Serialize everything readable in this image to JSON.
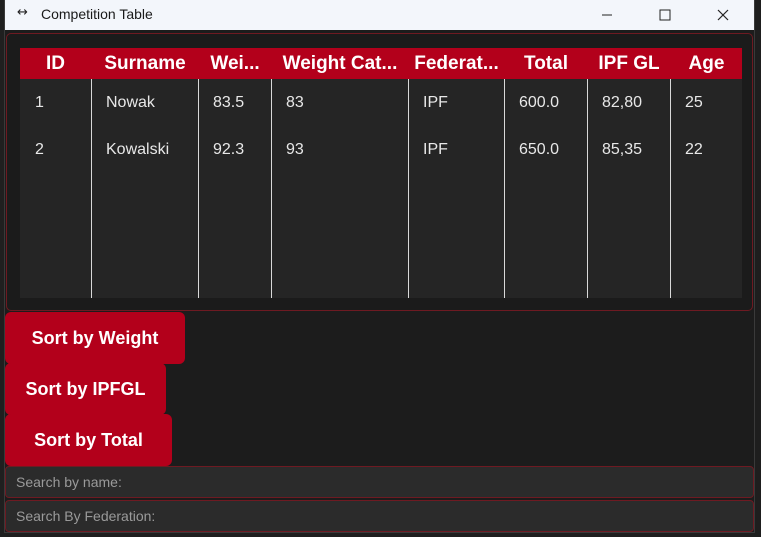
{
  "window": {
    "title": "Competition Table",
    "icon": "dumbbell-icon"
  },
  "table": {
    "headers": [
      "ID",
      "Surname",
      "Wei...",
      "Weight Cat...",
      "Federat...",
      "Total",
      "IPF GL",
      "Age"
    ],
    "rows": [
      [
        "1",
        "Nowak",
        "83.5",
        "83",
        "IPF",
        "600.0",
        "82,80",
        "25"
      ],
      [
        "2",
        "Kowalski",
        "92.3",
        "93",
        "IPF",
        "650.0",
        "85,35",
        "22"
      ]
    ]
  },
  "buttons": {
    "sort_weight": "Sort by Weight",
    "sort_ipfgl": "Sort by IPFGL",
    "sort_total": "Sort by Total"
  },
  "inputs": {
    "search_name_placeholder": "Search by name:",
    "search_federation_placeholder": "Search By Federation:"
  },
  "colors": {
    "accent": "#b3001b",
    "background": "#1c1c1c",
    "table_bg": "#252525"
  }
}
